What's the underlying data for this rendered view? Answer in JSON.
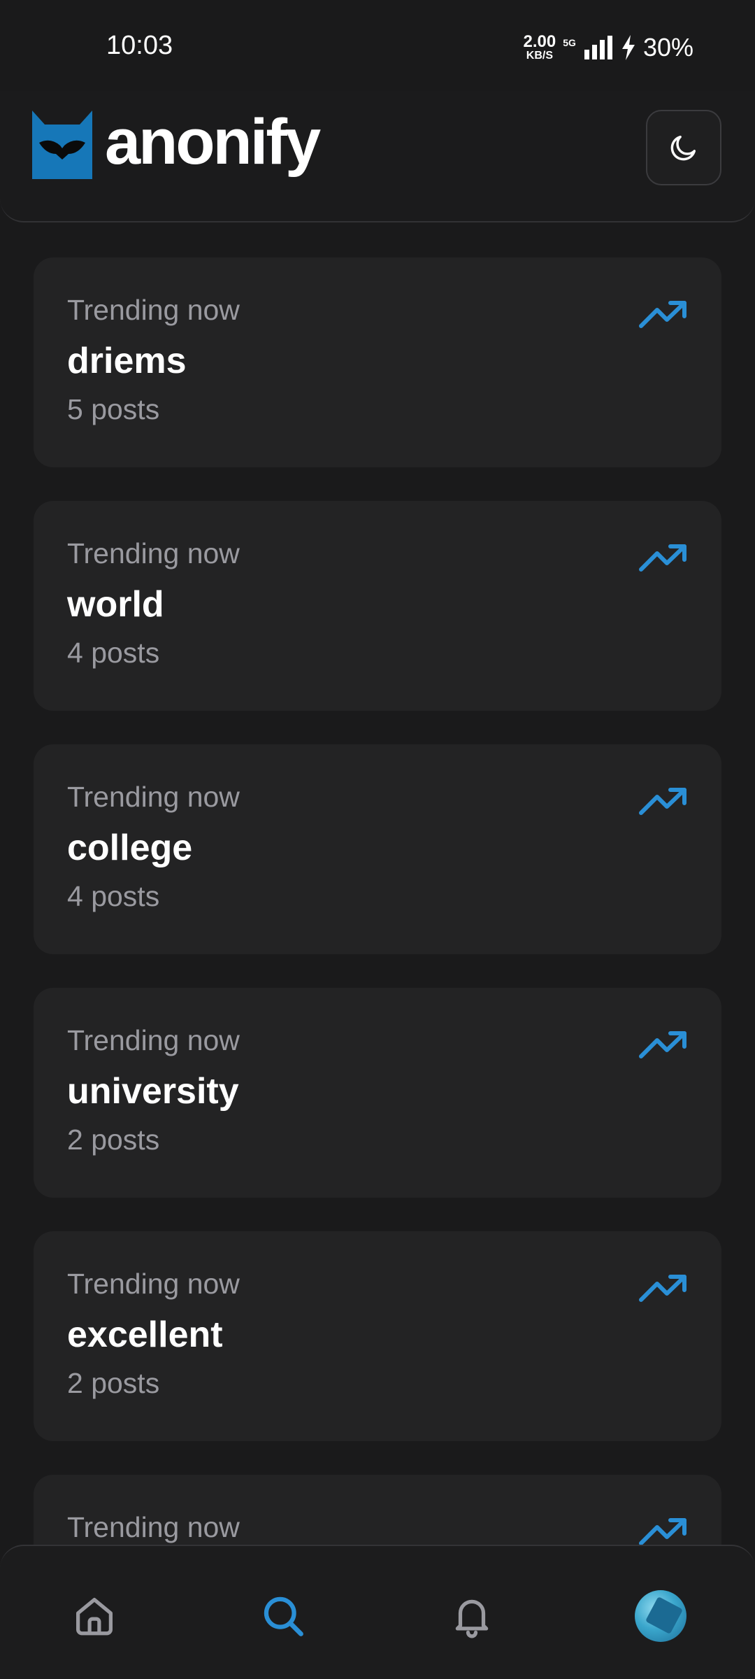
{
  "status_bar": {
    "time": "10:03",
    "net_speed_value": "2.00",
    "net_speed_unit": "KB/S",
    "network_type": "5G",
    "battery": "30%"
  },
  "header": {
    "logo_text": "anonify",
    "theme_toggle_icon": "moon-icon"
  },
  "trending": {
    "items": [
      {
        "kicker": "Trending now",
        "topic": "driems",
        "count": "5 posts"
      },
      {
        "kicker": "Trending now",
        "topic": "world",
        "count": "4 posts"
      },
      {
        "kicker": "Trending now",
        "topic": "college",
        "count": "4 posts"
      },
      {
        "kicker": "Trending now",
        "topic": "university",
        "count": "2 posts"
      },
      {
        "kicker": "Trending now",
        "topic": "excellent",
        "count": "2 posts"
      },
      {
        "kicker": "Trending now",
        "topic": "",
        "count": ""
      }
    ]
  },
  "bottom_nav": {
    "items": [
      "home-icon",
      "search-icon",
      "bell-icon",
      "avatar"
    ],
    "active": "search-icon"
  },
  "colors": {
    "accent": "#2a8fd6",
    "logo": "#1677b8",
    "background": "#1a1a1b",
    "card": "#232324",
    "muted_text": "#9a9aa0"
  }
}
